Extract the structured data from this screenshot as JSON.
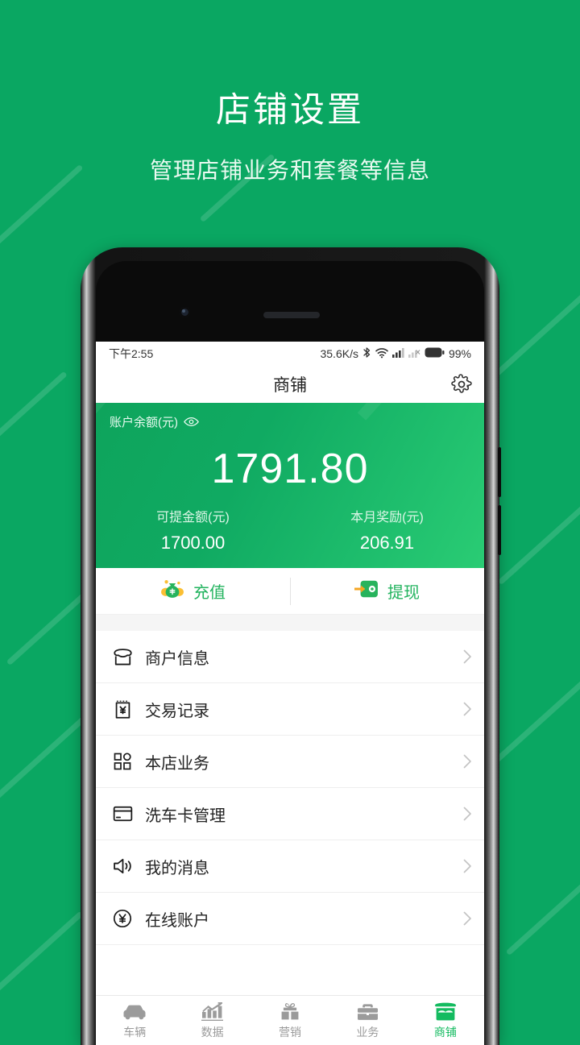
{
  "promo": {
    "title": "店铺设置",
    "subtitle": "管理店铺业务和套餐等信息",
    "bg_color": "#0AA762"
  },
  "status_bar": {
    "time": "下午2:55",
    "net_speed": "35.6K/s",
    "icons": [
      "bluetooth-icon",
      "wifi-icon",
      "signal-icon",
      "signal-off-icon",
      "battery-icon"
    ],
    "battery": "99%"
  },
  "nav_bar": {
    "title": "商铺",
    "settings_icon": "gear-icon"
  },
  "balance": {
    "label": "账户余额(元)",
    "eye_icon": "eye-icon",
    "amount": "1791.80",
    "stats": [
      {
        "label": "可提金额(元)",
        "value": "1700.00"
      },
      {
        "label": "本月奖励(元)",
        "value": "206.91"
      }
    ]
  },
  "actions": [
    {
      "label": "充值",
      "icon": "money-bag-icon"
    },
    {
      "label": "提现",
      "icon": "wallet-withdraw-icon"
    }
  ],
  "menu": [
    {
      "label": "商户信息",
      "icon": "store-icon"
    },
    {
      "label": "交易记录",
      "icon": "receipt-yen-icon"
    },
    {
      "label": "本店业务",
      "icon": "grid-icon"
    },
    {
      "label": "洗车卡管理",
      "icon": "card-icon"
    },
    {
      "label": "我的消息",
      "icon": "speaker-icon"
    },
    {
      "label": "在线账户",
      "icon": "yen-circle-icon"
    }
  ],
  "bottom_nav": {
    "active_color": "#14bb60",
    "inactive_color": "#9b9b9b",
    "items": [
      {
        "label": "车辆",
        "icon": "car-icon",
        "active": false
      },
      {
        "label": "数据",
        "icon": "bar-chart-icon",
        "active": false
      },
      {
        "label": "营销",
        "icon": "gift-icon",
        "active": false
      },
      {
        "label": "业务",
        "icon": "briefcase-icon",
        "active": false
      },
      {
        "label": "商铺",
        "icon": "shop-icon",
        "active": true
      }
    ]
  }
}
